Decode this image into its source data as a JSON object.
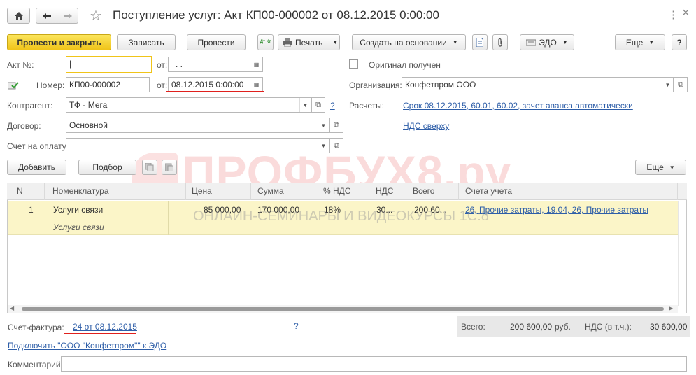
{
  "window": {
    "title": "Поступление услуг: Акт КП00-000002 от 08.12.2015 0:00:00",
    "close_glyph": "×",
    "menu_glyph": "⋮"
  },
  "toolbar": {
    "post_close": "Провести и закрыть",
    "save": "Записать",
    "post": "Провести",
    "print": "Печать",
    "create_based": "Создать на основании",
    "edo": "ЭДО",
    "more": "Еще",
    "help": "?",
    "dt_kt": "Дт Кт"
  },
  "form": {
    "act_no_label": "Акт №:",
    "act_no_value": "|",
    "from_label": "от:",
    "act_date_value": ". .",
    "number_label": "Номер:",
    "number_value": "КП00-000002",
    "date_value": "08.12.2015  0:00:00",
    "original_label": "Оригинал получен",
    "organization_label": "Организация:",
    "organization_value": "Конфетпром ООО",
    "contractor_label": "Контрагент:",
    "contractor_value": "ТФ - Мега",
    "contractor_help": "?",
    "settlements_label": "Расчеты:",
    "settlements_link": "Срок 08.12.2015, 60.01, 60.02, зачет аванса автоматически",
    "contract_label": "Договор:",
    "contract_value": "Основной",
    "vat_link": "НДС сверху",
    "invoice_pay_label": "Счет на оплату:",
    "invoice_pay_value": ""
  },
  "table_toolbar": {
    "add": "Добавить",
    "pick": "Подбор",
    "more": "Еще"
  },
  "table": {
    "headers": [
      "N",
      "Номенклатура",
      "Цена",
      "Сумма",
      "% НДС",
      "НДС",
      "Всего",
      "Счета учета"
    ],
    "rows": [
      {
        "n": "1",
        "item": "Услуги связи",
        "item_sub": "Услуги связи",
        "price": "85 000,00",
        "sum": "170 000,00",
        "vat_rate": "18%",
        "vat": "30...",
        "total": "200 60...",
        "accounts": "26, Прочие затраты, 19.04, 26, Прочие затраты"
      }
    ]
  },
  "footer": {
    "invoice_label": "Счет-фактура:",
    "invoice_link": "24 от 08.12.2015",
    "help": "?",
    "total_label": "Всего:",
    "total_value": "200 600,00",
    "currency": "руб.",
    "vat_label": "НДС (в т.ч.):",
    "vat_value": "30 600,00",
    "edo_link": "Подключить \"ООО \"Конфетпром\"\" к ЭДО",
    "comment_label": "Комментарий:",
    "comment_value": ""
  },
  "watermark": {
    "main": "ПРОФБУХ8.ру",
    "sub": "ОНЛАЙН-СЕМИНАРЫ И ВИДЕОКУРСЫ 1С:8"
  },
  "colors": {
    "accent_yellow": "#f0c419",
    "link_blue": "#2e5ea8",
    "highlight_red": "#e0201d",
    "row_selected": "#fbf5c8"
  }
}
